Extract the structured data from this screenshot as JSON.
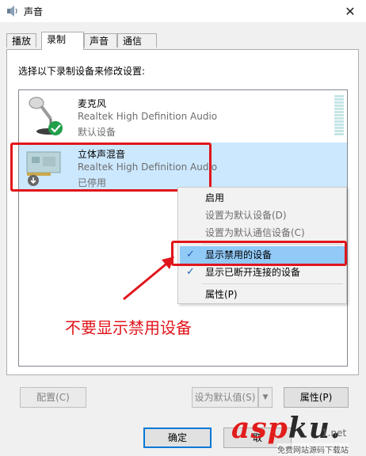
{
  "window": {
    "title": "声音",
    "close_glyph": "✕"
  },
  "tabs": [
    {
      "label": "播放",
      "active": false
    },
    {
      "label": "录制",
      "active": true
    },
    {
      "label": "声音",
      "active": false
    },
    {
      "label": "通信",
      "active": false
    }
  ],
  "instruction": "选择以下录制设备来修改设置:",
  "devices": [
    {
      "name": "麦克风",
      "driver": "Realtek High Definition Audio",
      "status": "默认设备",
      "icon": "microphone-icon",
      "badge": "default-check-badge",
      "selected": false
    },
    {
      "name": "立体声混音",
      "driver": "Realtek High Definition Audio",
      "status": "已停用",
      "icon": "sound-card-icon",
      "badge": "disabled-down-arrow-badge",
      "selected": true
    }
  ],
  "context_menu": {
    "items": [
      {
        "label": "启用",
        "disabled": false,
        "checked": false
      },
      {
        "label": "设置为默认设备(D)",
        "disabled": true,
        "checked": false
      },
      {
        "label": "设置为默认通信设备(C)",
        "disabled": true,
        "checked": false
      },
      {
        "label": "显示禁用的设备",
        "disabled": false,
        "checked": true,
        "hover": true
      },
      {
        "label": "显示已断开连接的设备",
        "disabled": false,
        "checked": true
      },
      {
        "label": "属性(P)",
        "disabled": false,
        "checked": false
      }
    ],
    "check_glyph": "✓"
  },
  "annotation": "不要显示禁用设备",
  "buttons": {
    "configure": "配置(C)",
    "set_default": "设为默认值(S)",
    "properties": "属性(P)",
    "ok": "确定",
    "cancel": "取"
  },
  "split_arrow_glyph": "▼",
  "watermark": {
    "main_a": "asp",
    "main_b": "ku",
    "main_dot": ".",
    "net": "1.net",
    "sub": "免费网站源码下载站"
  },
  "colors": {
    "accent": "#0078d7",
    "selection": "#cce8ff",
    "menu_hover": "#91c9f7",
    "annotation_red": "#e0161c"
  }
}
